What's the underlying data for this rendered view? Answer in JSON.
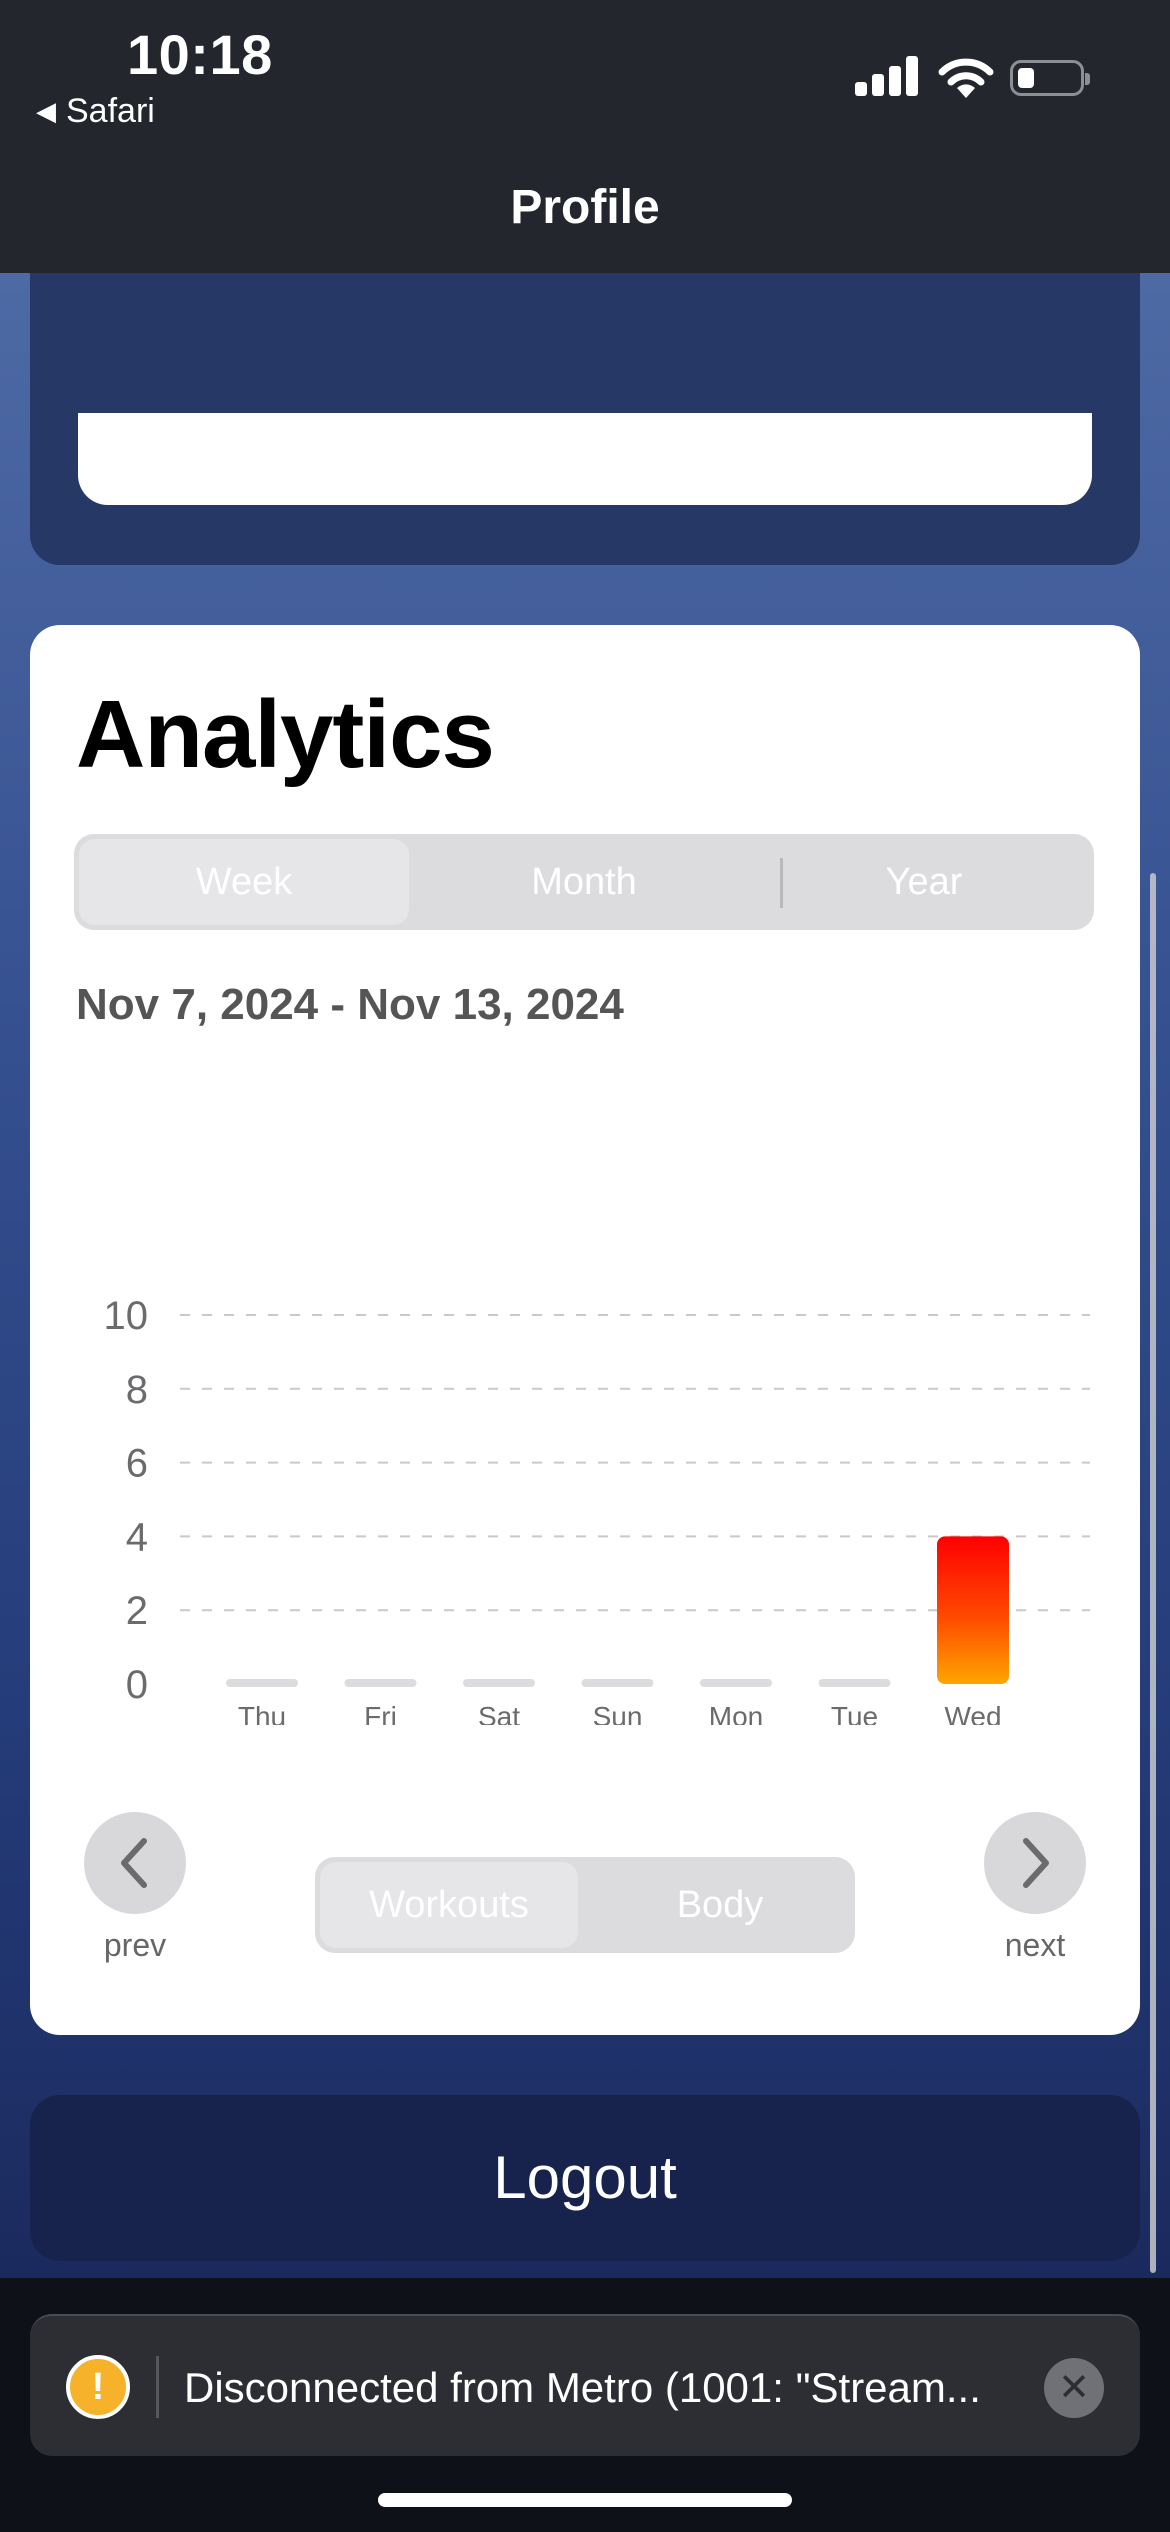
{
  "status_bar": {
    "time": "10:18",
    "back_app": "Safari"
  },
  "nav": {
    "title": "Profile"
  },
  "analytics": {
    "title": "Analytics",
    "period_tabs": [
      "Week",
      "Month",
      "Year"
    ],
    "selected_period": "Week",
    "date_range": "Nov 7, 2024 - Nov 13, 2024",
    "prev_label": "prev",
    "next_label": "next",
    "mode_tabs": [
      "Workouts",
      "Body"
    ],
    "selected_mode": "Workouts"
  },
  "chart_data": {
    "type": "bar",
    "categories": [
      "Thu",
      "Fri",
      "Sat",
      "Sun",
      "Mon",
      "Tue",
      "Wed"
    ],
    "values": [
      0,
      0,
      0,
      0,
      0,
      0,
      4
    ],
    "y_ticks": [
      0,
      2,
      4,
      6,
      8,
      10
    ],
    "ylim": [
      0,
      10
    ],
    "grid": true,
    "bar_gradient": [
      "#ff0000",
      "#ffa500"
    ],
    "empty_bar_color": "#dcdcde"
  },
  "logout_label": "Logout",
  "toast": {
    "message": "Disconnected from Metro (1001: \"Stream...",
    "warning_symbol": "!"
  }
}
